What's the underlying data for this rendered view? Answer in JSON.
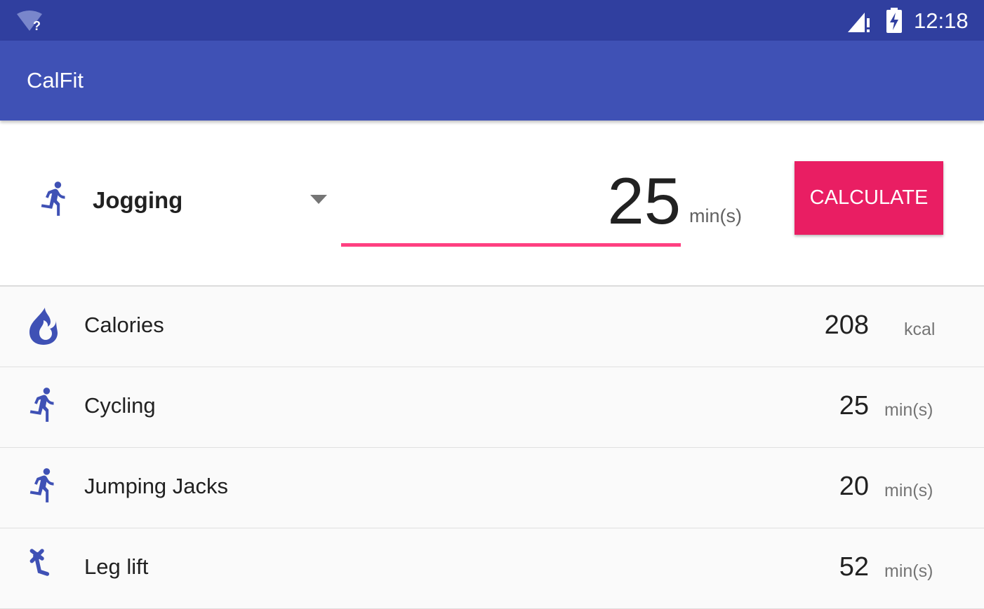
{
  "status_bar": {
    "time": "12:18",
    "wifi_icon": "wifi-unknown-icon",
    "signal_icon": "signal-alert-icon",
    "battery_icon": "battery-charging-icon",
    "colors": {
      "background": "#303f9f"
    }
  },
  "app_bar": {
    "title": "CalFit",
    "colors": {
      "background": "#3f51b5"
    }
  },
  "form": {
    "activity": {
      "icon": "run-icon",
      "selected": "Jogging"
    },
    "duration": {
      "value": "25",
      "unit": "min(s)"
    },
    "calculate_label": "CALCULATE",
    "colors": {
      "accent": "#ff4081",
      "button": "#e91e63",
      "icon": "#3f51b5"
    }
  },
  "results": [
    {
      "icon": "fire-icon",
      "label": "Calories",
      "value": "208",
      "unit": "kcal"
    },
    {
      "icon": "run-icon",
      "label": "Cycling",
      "value": "25",
      "unit": "min(s)"
    },
    {
      "icon": "run-icon",
      "label": "Jumping Jacks",
      "value": "20",
      "unit": "min(s)"
    },
    {
      "icon": "leg-lift-icon",
      "label": "Leg lift",
      "value": "52",
      "unit": "min(s)"
    }
  ]
}
